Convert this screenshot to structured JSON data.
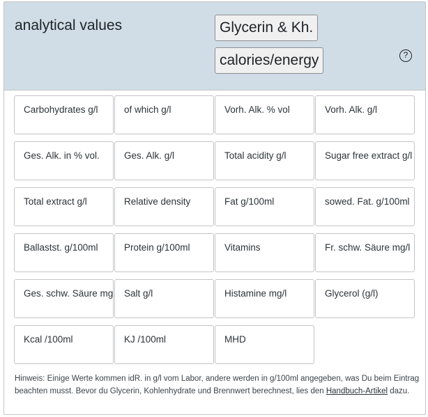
{
  "header": {
    "title": "analytical values",
    "glycerin_button": "Glycerin & Kh.",
    "calories_button": "calories/energy",
    "help_glyph": "?"
  },
  "fields": [
    "Carbohydrates g/l",
    "of which g/l",
    "Vorh. Alk. % vol",
    "Vorh. Alk. g/l",
    "Ges. Alk. in % vol.",
    "Ges. Alk. g/l",
    "Total acidity g/l",
    "Sugar free extract g/l",
    "Total extract g/l",
    "Relative density",
    "Fat g/100ml",
    "sowed. Fat. g/100ml",
    "Ballastst. g/100ml",
    "Protein g/100ml",
    "Vitamins",
    "Fr. schw. Säure mg/l",
    "Ges. schw. Säure mg/l",
    "Salt g/l",
    "Histamine mg/l",
    "Glycerol (g/l)",
    "Kcal /100ml",
    "KJ /100ml",
    "MHD"
  ],
  "note": {
    "text": "Hinweis: Einige Werte kommen idR. in g/l vom Labor, andere werden in g/100ml angegeben, was Du beim Eintrag beachten musst. Bevor du Glycerin, Kohlenhydrate und Brennwert berechnest, lies den ",
    "link": "Handbuch-Artikel",
    "suffix": " dazu."
  },
  "icons": {
    "help": "help-circle-icon"
  }
}
